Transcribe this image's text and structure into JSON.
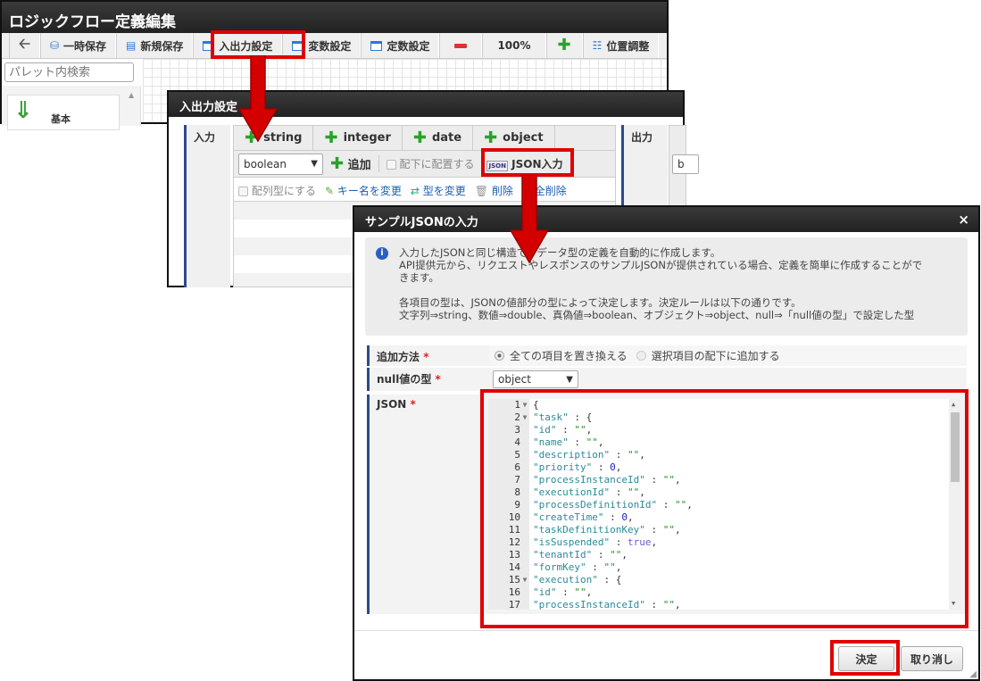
{
  "main_window": {
    "title": "ロジックフロー定義編集",
    "toolbar": {
      "save_temp": "一時保存",
      "save_new": "新規保存",
      "io_settings": "入出力設定",
      "var_settings": "変数設定",
      "const_settings": "定数設定",
      "zoom": "100%",
      "position_adjust": "位置調整"
    },
    "palette_search_placeholder": "パレット内検索",
    "palette_item": "基本"
  },
  "io_dialog": {
    "title": "入出力設定",
    "input_label": "入力",
    "output_label": "出力",
    "type_tabs": [
      "string",
      "integer",
      "date",
      "object"
    ],
    "type_select": "boolean",
    "add": "追加",
    "place_under": "配下に配置する",
    "json_input": "JSON入力",
    "array_type": "配列型にする",
    "rename_key": "キー名を変更",
    "change_type": "型を変更",
    "delete": "削除",
    "delete_all": "全削除",
    "output_select_partial": "b"
  },
  "json_dialog": {
    "title": "サンプルJSONの入力",
    "close": "×",
    "info": [
      "入力したJSONと同じ構造で、データ型の定義を自動的に作成します。",
      "API提供元から、リクエストやレスポンスのサンプルJSONが提供されている場合、定義を簡単に作成することがで",
      "きます。",
      "",
      "各項目の型は、JSONの値部分の型によって決定します。決定ルールは以下の通りです。",
      "文字列⇒string、数値⇒double、真偽値⇒boolean、オブジェクト⇒object、null⇒「null値の型」で設定した型"
    ],
    "add_method_label": "追加方法",
    "add_method_options": [
      "全ての項目を置き換える",
      "選択項目の配下に追加する"
    ],
    "add_method_selected": 0,
    "null_type_label": "null値の型",
    "null_type_value": "object",
    "json_label": "JSON",
    "json_lines": [
      "{",
      "  \"task\" : {",
      "    \"id\" : \"\",",
      "    \"name\" : \"\",",
      "    \"description\" : \"\",",
      "    \"priority\" : 0,",
      "    \"processInstanceId\" : \"\",",
      "    \"executionId\" : \"\",",
      "    \"processDefinitionId\" : \"\",",
      "    \"createTime\" : 0,",
      "    \"taskDefinitionKey\" : \"\",",
      "    \"isSuspended\" : true,",
      "    \"tenantId\" : \"\",",
      "    \"formKey\" : \"\",",
      "    \"execution\" : {",
      "      \"id\" : \"\",",
      "      \"processInstanceId\" : \"\","
    ],
    "fold_lines": [
      1,
      2,
      15
    ],
    "ok": "決定",
    "cancel": "取り消し"
  },
  "colors": {
    "highlight": "#e00000",
    "accent": "#2e4a8c"
  }
}
